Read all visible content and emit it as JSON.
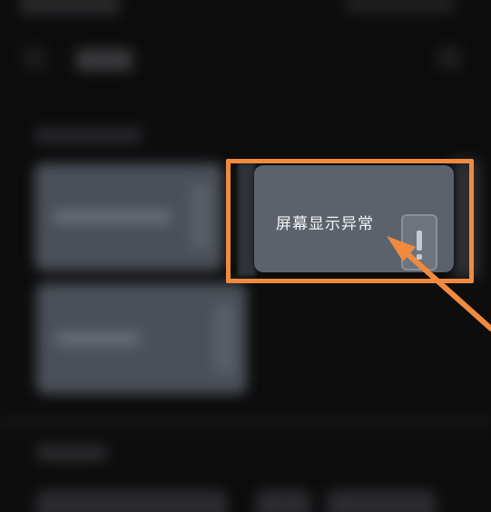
{
  "focus_card": {
    "label": "屏幕显示异常",
    "icon": "warning-icon"
  },
  "annotation": {
    "highlight_color": "#f08a3e",
    "arrow_color": "#f08a3e"
  }
}
